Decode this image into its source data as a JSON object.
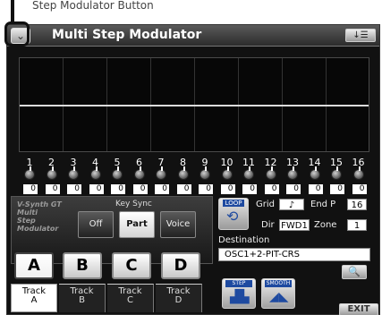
{
  "caption": "Step Modulator Button",
  "titlebar": {
    "menu_glyph": "⌄",
    "title": "Multi Step Modulator",
    "window_button": "↓☰"
  },
  "steps": [
    {
      "num": "1",
      "value": "0"
    },
    {
      "num": "2",
      "value": "0"
    },
    {
      "num": "3",
      "value": "0"
    },
    {
      "num": "4",
      "value": "0"
    },
    {
      "num": "5",
      "value": "0"
    },
    {
      "num": "6",
      "value": "0"
    },
    {
      "num": "7",
      "value": "0"
    },
    {
      "num": "8",
      "value": "0"
    },
    {
      "num": "9",
      "value": "0"
    },
    {
      "num": "10",
      "value": "0"
    },
    {
      "num": "11",
      "value": "0"
    },
    {
      "num": "12",
      "value": "0"
    },
    {
      "num": "13",
      "value": "0"
    },
    {
      "num": "14",
      "value": "0"
    },
    {
      "num": "15",
      "value": "0"
    },
    {
      "num": "16",
      "value": "0"
    }
  ],
  "left_panel": {
    "brand_line1": "V-Synth GT",
    "brand_line2": "Multi",
    "brand_line3": "Step",
    "brand_line4": "Modulator",
    "key_sync_label": "Key Sync",
    "key_sync_options": [
      "Off",
      "Part",
      "Voice"
    ],
    "key_sync_selected": "Part"
  },
  "tracks": {
    "letters": [
      "A",
      "B",
      "C",
      "D"
    ],
    "tabs": [
      {
        "line1": "Track",
        "line2": "A"
      },
      {
        "line1": "Track",
        "line2": "B"
      },
      {
        "line1": "Track",
        "line2": "C"
      },
      {
        "line1": "Track",
        "line2": "D"
      }
    ],
    "selected": "A"
  },
  "right_panel": {
    "loop_label": "LOOP",
    "grid_label": "Grid",
    "grid_value": "♪",
    "end_label": "End P",
    "end_value": "16",
    "dir_label": "Dir",
    "dir_value": "FWD1",
    "zone_label": "Zone",
    "zone_value": "1",
    "destination_label": "Destination",
    "destination_value": "OSC1+2-PIT-CRS",
    "search_glyph": "🔍",
    "step_label": "STEP",
    "smooth_label": "SMOOTH"
  },
  "exit_label": "EXIT",
  "colors": {
    "screen_bg": "#111111",
    "accent_blue": "#1e4aa0",
    "waveform": "#dcdcdc"
  }
}
